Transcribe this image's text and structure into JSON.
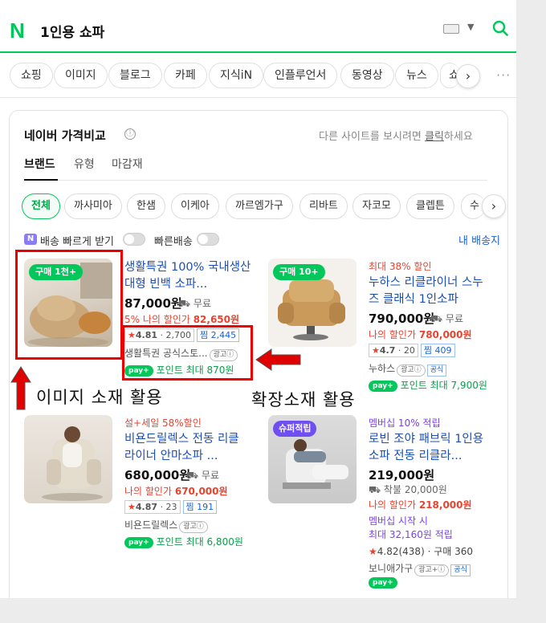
{
  "search": {
    "logo": "N",
    "query": "1인용 쇼파"
  },
  "tabs": [
    "쇼핑",
    "이미지",
    "블로그",
    "카페",
    "지식iN",
    "인플루언서",
    "동영상",
    "뉴스",
    "쇼"
  ],
  "panel": {
    "title": "네이버 가격비교",
    "info_icon": "ⓘ",
    "other_prefix": "다른 사이트를 보시려면 ",
    "other_link": "클릭",
    "other_suffix": "하세요",
    "subtabs": [
      "브랜드",
      "유형",
      "마감재"
    ],
    "brands": [
      "전체",
      "까사미아",
      "한샘",
      "이케아",
      "까르엠가구",
      "리바트",
      "자코모",
      "클렙튼",
      "수"
    ],
    "filter_badge": "N",
    "filter_fast": "배송 빠르게 받기",
    "filter_quick": "빠른배송",
    "my_shipping": "내 배송지"
  },
  "products": [
    {
      "badge": "구매 1천+",
      "name": "생활특권 100% 국내생산 대형 빈백 소파...",
      "price": "87,000원",
      "ship": "무료",
      "discount_label": "5% 나의 할인가",
      "discount_price": "82,650원",
      "rating": "4.81",
      "reviews": "2,700",
      "zzim": "찜 2,445",
      "store": "생활특권 공식스토...",
      "ad": "광고ⓘ",
      "npay_logo": "pay+",
      "point": "포인트 최대 870원"
    },
    {
      "badge": "구매 10+",
      "promo": "최대 38% 할인",
      "name": "누하스 리클라이너 스누즈 클래식 1인소파",
      "price": "790,000원",
      "ship": "무료",
      "discount_label": "나의 할인가",
      "discount_price": "780,000원",
      "rating": "4.7",
      "reviews": "20",
      "zzim": "찜 409",
      "store": "누하스",
      "ad": "광고ⓘ",
      "official": "공식",
      "npay_logo": "pay+",
      "point": "포인트 최대 7,900원"
    },
    {
      "promo": "설+세일 58%할인",
      "name": "비욘드릴렉스 전동 리클라이너 안마소파 ...",
      "price": "680,000원",
      "ship": "무료",
      "discount_label": "나의 할인가",
      "discount_price": "670,000원",
      "rating": "4.87",
      "reviews": "23",
      "zzim": "찜 191",
      "store": "비욘드릴렉스",
      "ad": "광고ⓘ",
      "npay_logo": "pay+",
      "point": "포인트 최대 6,800원"
    },
    {
      "badge": "슈퍼적립",
      "promo": "멤버십 10% 적립",
      "name": "로빈 조야 패브릭 1인용 소파 전동 리클라...",
      "price": "219,000원",
      "ship": "착불 20,000원",
      "discount_label": "나의 할인가",
      "discount_price": "218,000원",
      "membership_start": "멤버십 시작 시",
      "membership_reward": "최대 32,160원 적립",
      "rating_line": "4.82(438) · 구매 360",
      "store": "보니애가구",
      "ad": "광고+ⓘ",
      "official": "공식",
      "npay_logo": "pay+"
    }
  ],
  "annotations": {
    "image": "이미지 소재 활용",
    "extension": "확장소재 활용"
  },
  "colors": {
    "naver_green": "#03c75a",
    "link_blue": "#1a4fb8",
    "sale_red": "#e8432f",
    "annotation_red": "#e00000"
  }
}
